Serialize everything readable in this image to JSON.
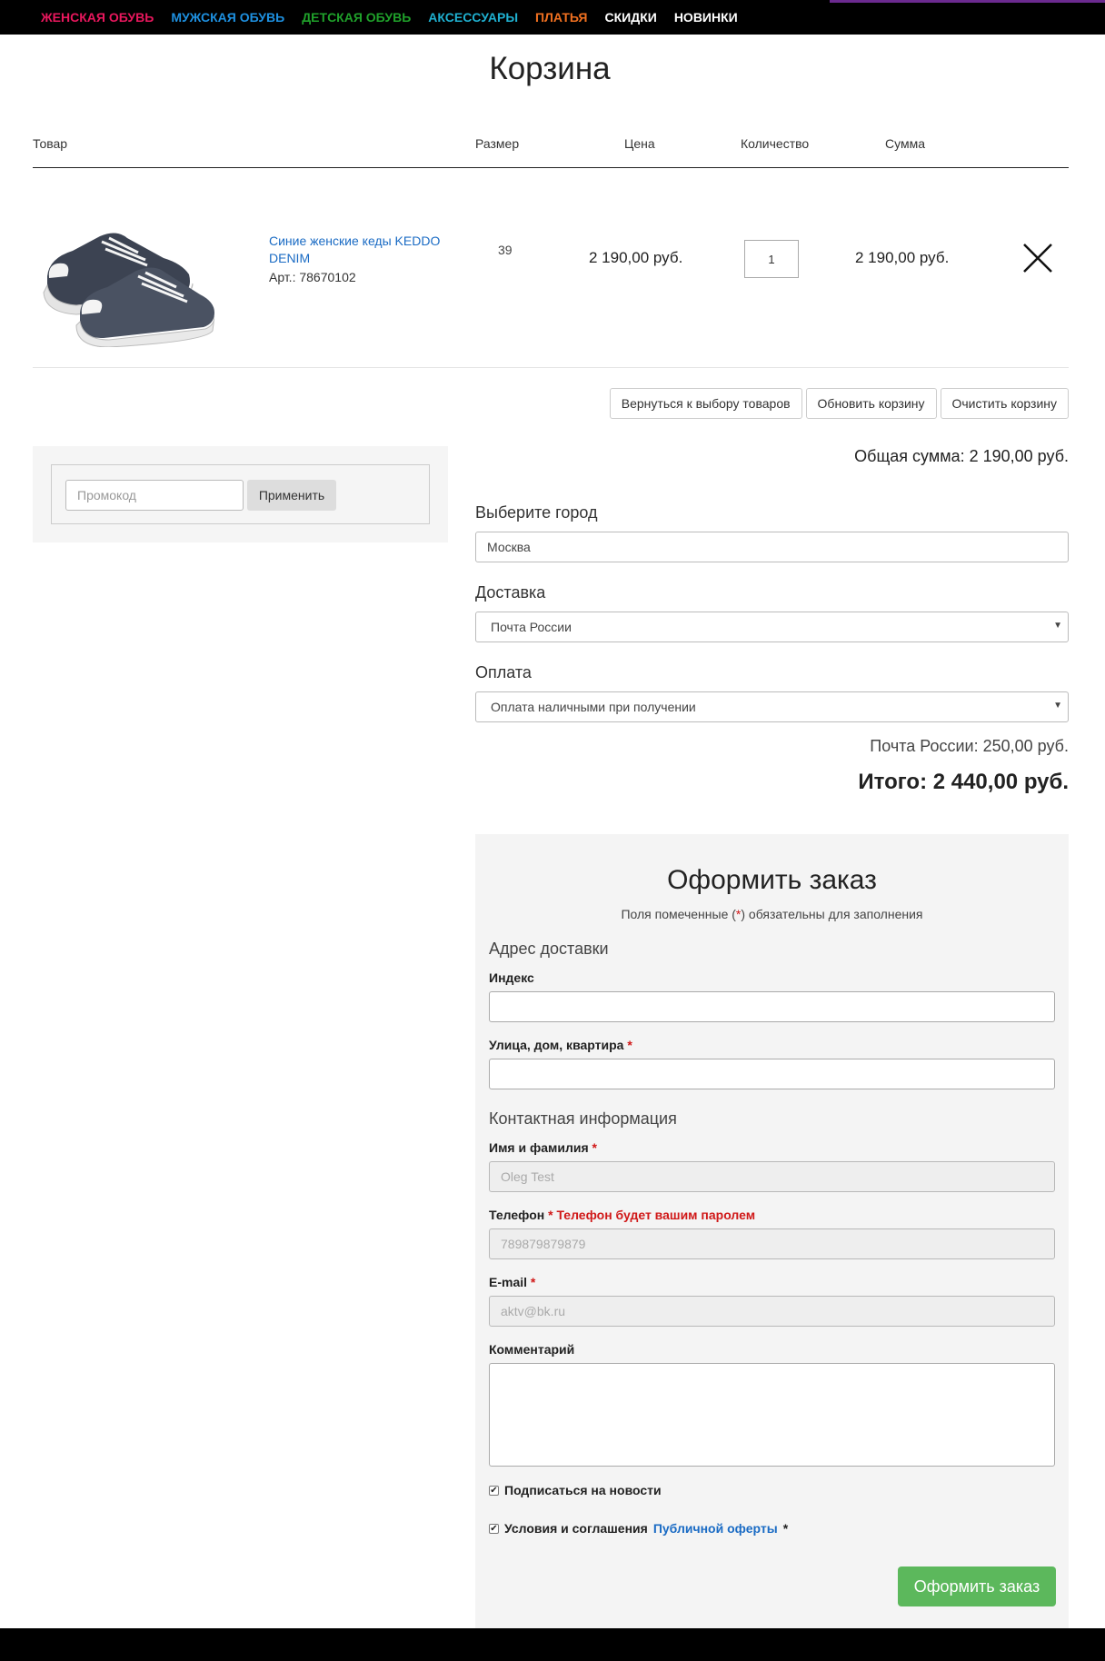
{
  "nav": {
    "items": [
      {
        "label": "ЖЕНСКАЯ ОБУВЬ",
        "color": "#e8175d"
      },
      {
        "label": "МУЖСКАЯ ОБУВЬ",
        "color": "#1e90e0"
      },
      {
        "label": "ДЕТСКАЯ ОБУВЬ",
        "color": "#1fa02a"
      },
      {
        "label": "АКСЕССУАРЫ",
        "color": "#1fb0d0"
      },
      {
        "label": "ПЛАТЬЯ",
        "color": "#f07020"
      },
      {
        "label": "СКИДКИ",
        "color": "#ffffff"
      },
      {
        "label": "НОВИНКИ",
        "color": "#ffffff"
      }
    ],
    "accent_bar_color": "#6b2a8f"
  },
  "page": {
    "title": "Корзина"
  },
  "cart": {
    "headers": {
      "product": "Товар",
      "size": "Размер",
      "price": "Цена",
      "quantity": "Количество",
      "sum": "Сумма"
    },
    "item": {
      "name": "Синие женские кеды KEDDO DENIM",
      "article": "Арт.: 78670102",
      "size": "39",
      "price": "2 190,00 руб.",
      "quantity": "1",
      "sum": "2 190,00 руб.",
      "image_icon": "sneakers-image",
      "remove_icon": "close-icon"
    },
    "buttons": {
      "back": "Вернуться к выбору товаров",
      "update": "Обновить корзину",
      "clear": "Очистить корзину"
    },
    "total": "Общая сумма: 2 190,00 руб."
  },
  "promo": {
    "placeholder": "Промокод",
    "apply": "Применить"
  },
  "checkout": {
    "city_label": "Выберите город",
    "city_value": "Москва",
    "delivery_label": "Доставка",
    "delivery_value": "Почта России",
    "payment_label": "Оплата",
    "payment_value": "Оплата наличными при получении",
    "delivery_cost": "Почта России: 250,00 руб.",
    "grand_total": "Итого: 2 440,00 руб."
  },
  "order": {
    "title": "Оформить заказ",
    "note_before": "Поля помеченные (",
    "note_star": "*",
    "note_after": ") обязательны для заполнения",
    "address_section": "Адрес доставки",
    "index_label": "Индекс",
    "street_label": "Улица, дом, квартира",
    "contact_section": "Контактная информация",
    "name_label": "Имя и фамилия",
    "name_value": "Oleg Test",
    "phone_label": "Телефон",
    "phone_hint": "Телефон будет вашим паролем",
    "phone_value": "789879879879",
    "email_label": "E-mail",
    "email_value": "aktv@bk.ru",
    "comment_label": "Комментарий",
    "subscribe_label": "Подписаться на новости",
    "terms_label": "Условия и соглашения",
    "terms_link": "Публичной оферты",
    "star": "*",
    "submit": "Оформить заказ",
    "submit_color": "#5cb85c"
  }
}
